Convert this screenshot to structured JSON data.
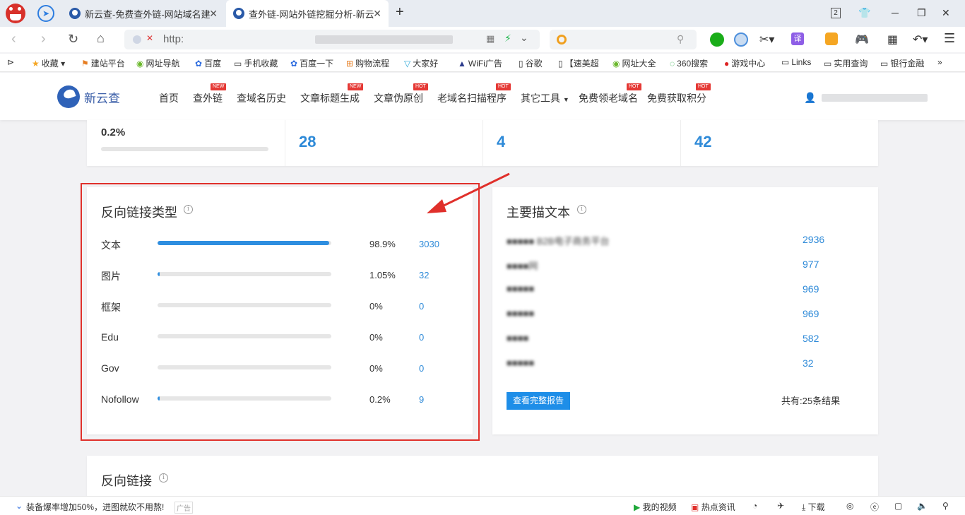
{
  "browser": {
    "tabs": [
      {
        "title": "新云查-免费查外链-网站域名建"
      },
      {
        "title": "查外链-网站外链挖掘分析-新云"
      }
    ],
    "tab_count": "2",
    "url_prefix": "http:",
    "bookmarks": [
      "收藏",
      "建站平台",
      "网址导航",
      "百度",
      "手机收藏",
      "百度一下",
      "购物流程",
      "大家好",
      "WiFi广告",
      "谷歌",
      "【速美超",
      "网址大全",
      "360搜索",
      "游戏中心",
      "Links",
      "实用查询",
      "银行金融"
    ]
  },
  "site": {
    "logo_text": "新云查",
    "nav": [
      {
        "label": "首页",
        "badge": ""
      },
      {
        "label": "查外链",
        "badge": "NEW"
      },
      {
        "label": "查域名历史",
        "badge": ""
      },
      {
        "label": "文章标题生成",
        "badge": "NEW"
      },
      {
        "label": "文章伪原创",
        "badge": "HOT"
      },
      {
        "label": "老域名扫描程序",
        "badge": "HOT"
      },
      {
        "label": "其它工具",
        "badge": ""
      },
      {
        "label": "免费领老域名",
        "badge": "HOT"
      },
      {
        "label": "免费获取积分",
        "badge": "HOT"
      }
    ]
  },
  "stats": {
    "percent": "0.2%",
    "values": [
      "28",
      "4",
      "42"
    ]
  },
  "backlink_types": {
    "title": "反向链接类型",
    "rows": [
      {
        "label": "文本",
        "pct": "98.9%",
        "count": "3030",
        "fraction": 0.989
      },
      {
        "label": "图片",
        "pct": "1.05%",
        "count": "32",
        "fraction": 0.0105
      },
      {
        "label": "框架",
        "pct": "0%",
        "count": "0",
        "fraction": 0
      },
      {
        "label": "Edu",
        "pct": "0%",
        "count": "0",
        "fraction": 0
      },
      {
        "label": "Gov",
        "pct": "0%",
        "count": "0",
        "fraction": 0
      },
      {
        "label": "Nofollow",
        "pct": "0.2%",
        "count": "9",
        "fraction": 0.002
      }
    ]
  },
  "anchors": {
    "title": "主要描文本",
    "rows": [
      {
        "text": "■■■■■ B2B电子商务平台",
        "count": "2936"
      },
      {
        "text": "■■■■网",
        "count": "977"
      },
      {
        "text": "■■■■■",
        "count": "969"
      },
      {
        "text": "■■■■■",
        "count": "969"
      },
      {
        "text": "■■■■",
        "count": "582"
      },
      {
        "text": "■■■■■",
        "count": "32"
      }
    ],
    "report_button": "查看完整报告",
    "total": "共有:25条结果"
  },
  "backlinks_section": {
    "title": "反向链接"
  },
  "statusbar": {
    "ad_text": "装备爆率增加50%，进图就砍不用熬!",
    "ad_tag": "广告",
    "items": [
      "我的视频",
      "热点资讯",
      "下载"
    ]
  }
}
